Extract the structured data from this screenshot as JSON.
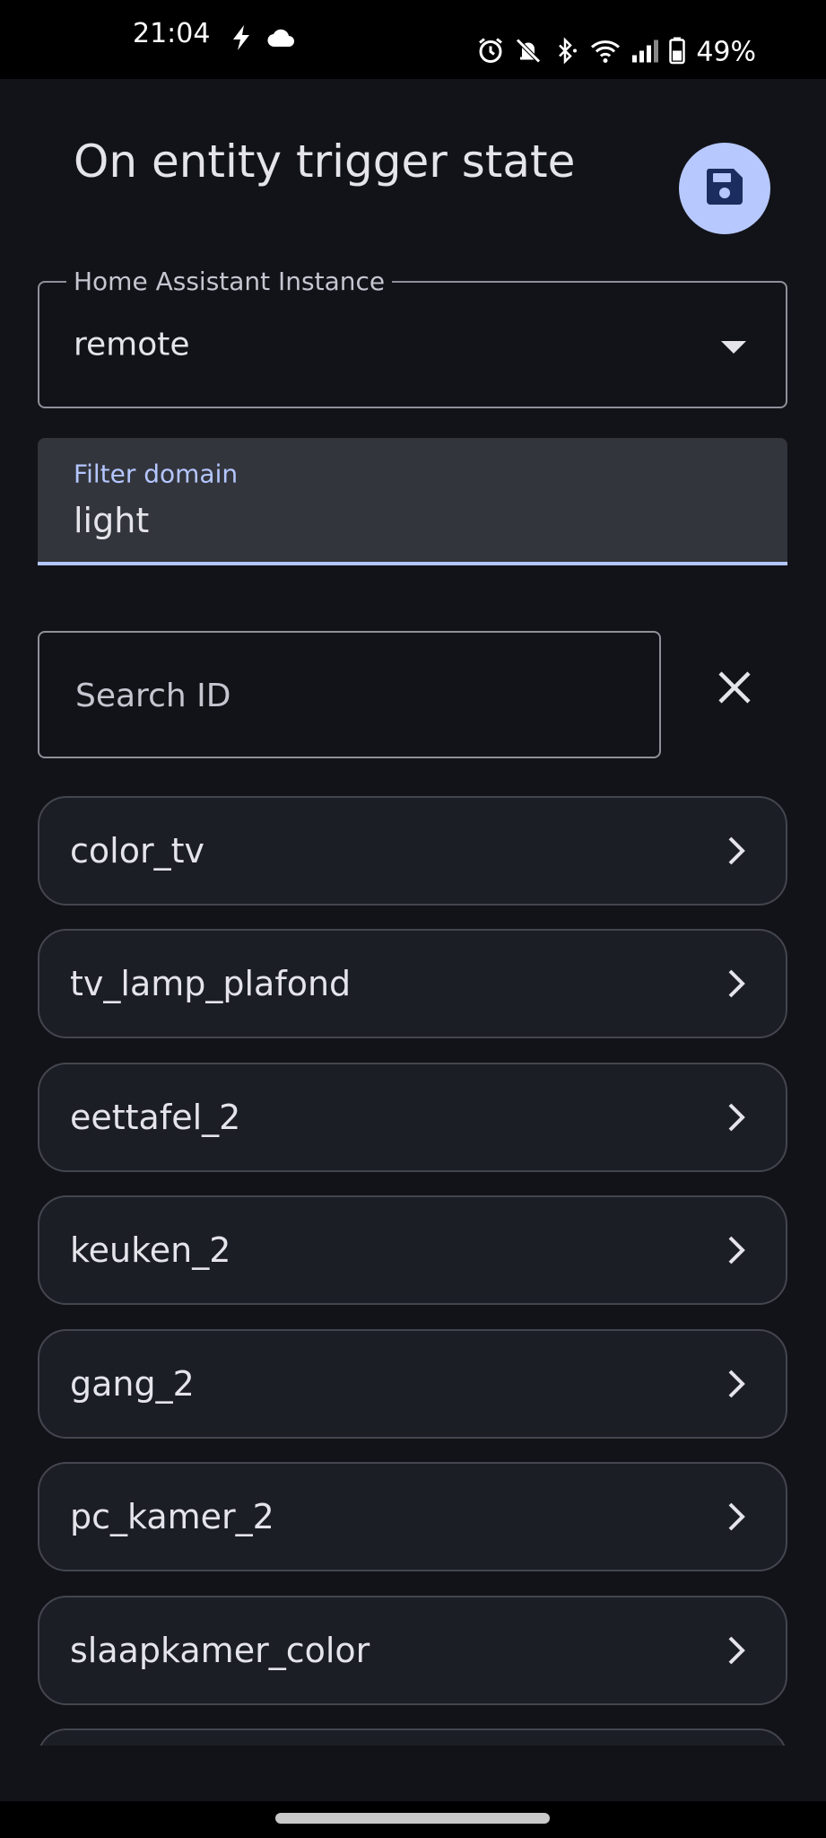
{
  "status_bar": {
    "time": "21:04",
    "battery": "49%",
    "icons_left": [
      "flash-icon",
      "cloud-icon"
    ],
    "icons_right": [
      "alarm-icon",
      "mute-icon",
      "bluetooth-icon",
      "wifi-icon",
      "signal-icon",
      "battery-icon"
    ]
  },
  "header": {
    "title": "On entity trigger state",
    "save_icon": "save-icon"
  },
  "instance_select": {
    "label": "Home Assistant Instance",
    "value": "remote"
  },
  "filter_domain": {
    "label": "Filter domain",
    "value": "light"
  },
  "search": {
    "placeholder": "Search ID",
    "value": ""
  },
  "entities": [
    {
      "label": "color_tv"
    },
    {
      "label": "tv_lamp_plafond"
    },
    {
      "label": "eettafel_2"
    },
    {
      "label": "keuken_2"
    },
    {
      "label": "gang_2"
    },
    {
      "label": "pc_kamer_2"
    },
    {
      "label": "slaapkamer_color"
    }
  ],
  "colors": {
    "background": "#121318",
    "accent": "#b4c6ff",
    "save_button": "#b7c8ff",
    "list_item_bg": "#1c1e26"
  }
}
